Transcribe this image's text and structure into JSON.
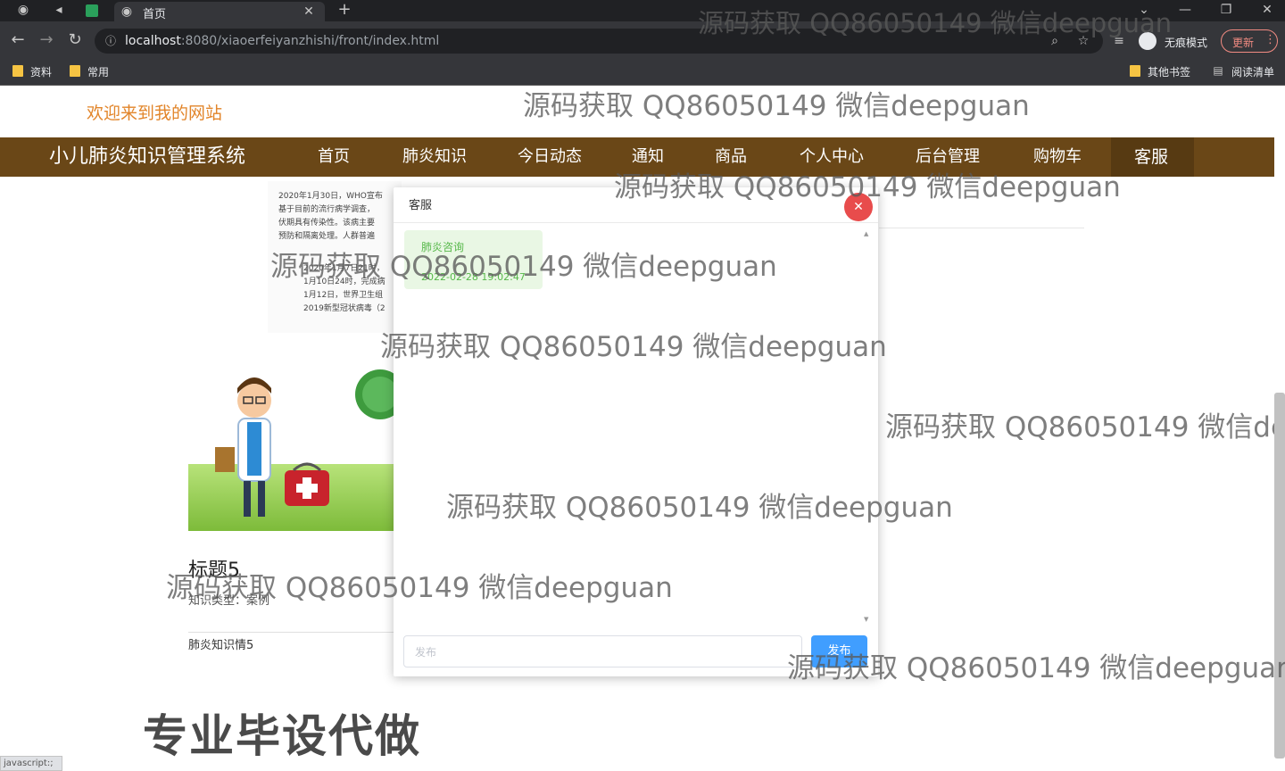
{
  "browser": {
    "tab_title": "首页",
    "url_host": "localhost",
    "url_rest": ":8080/xiaoerfeiyanzhishi/front/index.html",
    "incognito_label": "无痕模式",
    "update_label": "更新",
    "bookmarks": [
      "资料",
      "常用"
    ],
    "other_bookmarks": "其他书签",
    "reading_list": "阅读清单"
  },
  "site": {
    "welcome": "欢迎来到我的网站",
    "brand": "小儿肺炎知识管理系统",
    "nav": [
      "首页",
      "肺炎知识",
      "今日动态",
      "通知",
      "商品",
      "个人中心",
      "后台管理",
      "购物车",
      "客服"
    ],
    "active_nav_index": 8
  },
  "article": {
    "doc_lines": [
      "2020年1月30日，WHO宣布",
      "基于目前的流行病学调查，",
      "伏期具有传染性。该病主要",
      "预防和隔离处理。人群普遍",
      "2020年1月7日21时，",
      "1月10日24时，完成病",
      "1月12日，世界卫生组",
      "2019新型冠状病毒（2"
    ],
    "card_title": "标题5",
    "type_label": "知识类型：",
    "type_value": "案例",
    "detail": "肺炎知识情5",
    "status_bar": "javascript:;"
  },
  "chat": {
    "title": "客服",
    "message": "肺炎咨询",
    "message_time": "2022-02-28 19:02:47",
    "input_placeholder": "发布",
    "send_label": "发布"
  },
  "watermark": {
    "text": "源码获取 QQ86050149 微信deepguan",
    "bottom_banner": "专业毕设代做"
  },
  "colors": {
    "nav_bg": "#6a4717",
    "welcome": "#e2852a",
    "send_btn": "#409eff",
    "message_bg": "#e9f7e4",
    "close_btn": "#e84c4c"
  }
}
